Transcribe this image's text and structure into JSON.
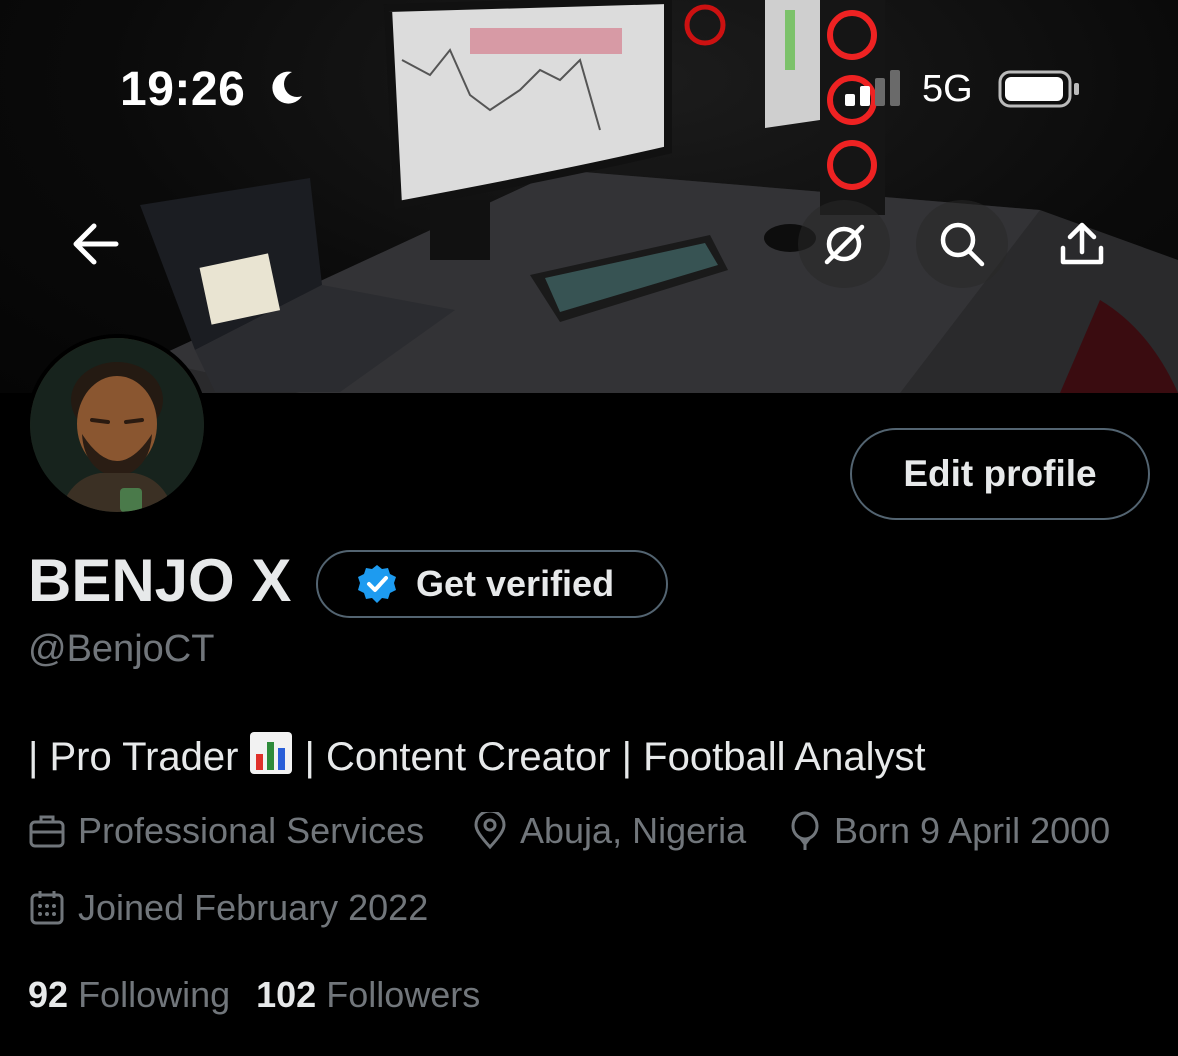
{
  "status_bar": {
    "time": "19:26",
    "network": "5G"
  },
  "header": {
    "back_icon": "arrow-left-icon",
    "grok_icon": "grok-icon",
    "search_icon": "search-icon",
    "share_icon": "share-icon"
  },
  "profile": {
    "edit_button": "Edit profile",
    "name": "BENJO X",
    "verify_button": "Get verified",
    "handle": "@BenjoCT",
    "bio_part1": "| Pro Trader",
    "bio_part2": "| Content Creator | Football Analyst",
    "category": "Professional Services",
    "location": "Abuja, Nigeria",
    "birthday": "Born 9 April 2000",
    "joined": "Joined February 2022",
    "following_count": "92",
    "following_label": "Following",
    "followers_count": "102",
    "followers_label": "Followers"
  },
  "colors": {
    "background": "#000000",
    "text_primary": "#e7e9ea",
    "text_secondary": "#71767b",
    "border": "#536471",
    "verified_blue": "#1d9bf0"
  }
}
